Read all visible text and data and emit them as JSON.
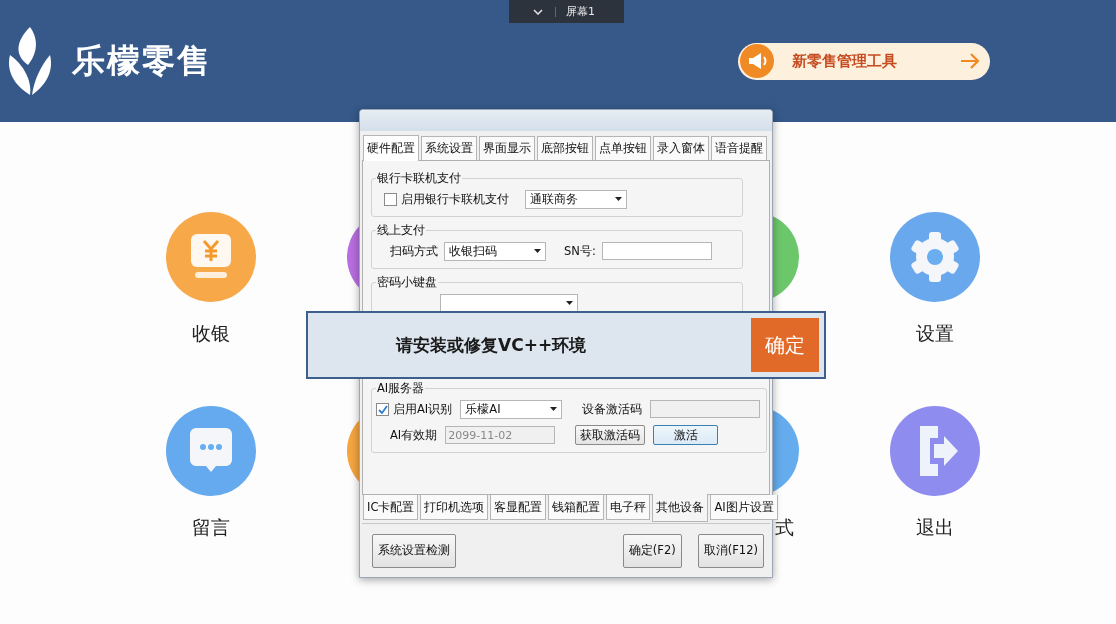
{
  "screen_switcher": {
    "label": "屏幕1"
  },
  "header": {
    "brand": "乐檬零售",
    "promo": "新零售管理工具"
  },
  "tiles": [
    {
      "kind": "cashier",
      "label": "收银",
      "color": "#f7a94a"
    },
    {
      "kind": "plain",
      "color": "#b76ee0"
    },
    {
      "kind": "plain",
      "color": "#6cc66a"
    },
    {
      "kind": "settings",
      "label": "设置",
      "color": "#6aa8ee"
    },
    {
      "kind": "message",
      "label": "留言",
      "color": "#65aaee"
    },
    {
      "kind": "plain",
      "color": "#f5a540"
    },
    {
      "kind": "plain",
      "label": "式",
      "color": "#64acee"
    },
    {
      "kind": "exit",
      "label": "退出",
      "color": "#8f8cf0"
    }
  ],
  "dialog": {
    "tabs": [
      {
        "label": "硬件配置",
        "selected": true
      },
      {
        "label": "系统设置",
        "selected": false
      },
      {
        "label": "界面显示",
        "selected": false
      },
      {
        "label": "底部按钮",
        "selected": false
      },
      {
        "label": "点单按钮",
        "selected": false
      },
      {
        "label": "录入窗体",
        "selected": false
      },
      {
        "label": "语音提醒",
        "selected": false
      }
    ],
    "groups": [
      {
        "title": "银行卡联机支付",
        "rows": [
          [
            {
              "kind": "checkbox",
              "label": "启用银行卡联机支付",
              "checked": false
            },
            {
              "kind": "combo",
              "value": "通联商务"
            }
          ]
        ]
      },
      {
        "title": "线上支付",
        "rows": [
          [
            {
              "kind": "label",
              "text": "扫码方式"
            },
            {
              "kind": "combo",
              "value": "收银扫码"
            },
            {
              "kind": "label",
              "text": "SN号:"
            },
            {
              "kind": "input",
              "disabled": false
            }
          ]
        ]
      },
      {
        "title": "密码小键盘",
        "rows": [
          [
            {
              "kind": "combo"
            }
          ]
        ]
      },
      {
        "title": "AI服务器",
        "rows": [
          [
            {
              "kind": "checkbox",
              "label": "启用AI识别",
              "checked": true
            },
            {
              "kind": "combo",
              "value": "乐檬AI"
            },
            {
              "kind": "label",
              "text": "设备激活码"
            },
            {
              "kind": "input",
              "disabled": true
            }
          ],
          [
            {
              "kind": "label",
              "text": "AI有效期"
            },
            {
              "kind": "input",
              "value": "2099-11-02",
              "disabled": true
            },
            {
              "kind": "button",
              "label": "获取激活码",
              "focused": false
            },
            {
              "kind": "button",
              "label": "激活",
              "focused": true
            }
          ]
        ]
      }
    ],
    "bottom_tabs": [
      {
        "label": "IC卡配置",
        "selected": false
      },
      {
        "label": "打印机选项",
        "selected": false
      },
      {
        "label": "客显配置",
        "selected": false
      },
      {
        "label": "钱箱配置",
        "selected": false
      },
      {
        "label": "电子秤",
        "selected": false
      },
      {
        "label": "其他设备",
        "selected": true
      },
      {
        "label": "AI图片设置",
        "selected": false
      }
    ],
    "buttons": [
      {
        "label": "系统设置检测"
      },
      {
        "label": "确定(F2)"
      },
      {
        "label": "取消(F12)"
      }
    ]
  },
  "alert": {
    "message": "请安装或修复VC++环境",
    "button": "确定"
  }
}
